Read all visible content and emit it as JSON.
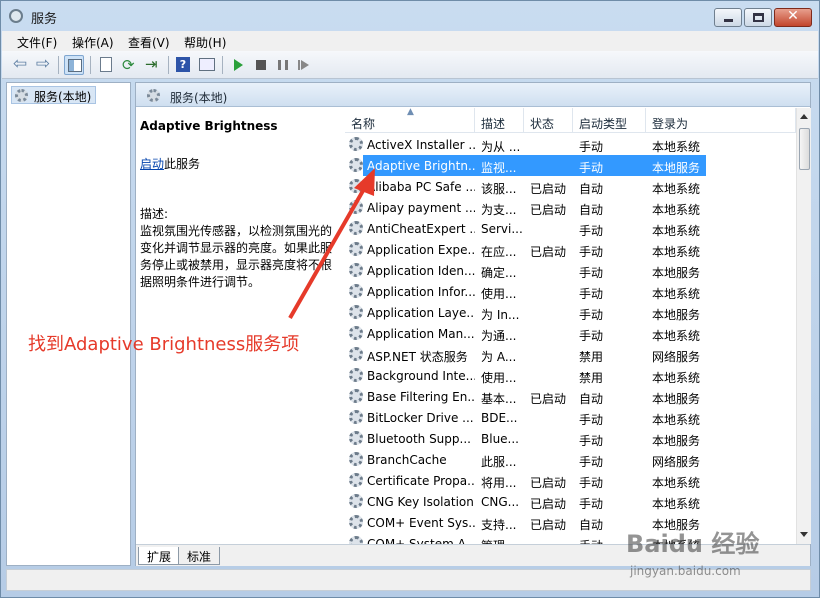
{
  "window": {
    "title": "服务"
  },
  "menu": [
    "文件(F)",
    "操作(A)",
    "查看(V)",
    "帮助(H)"
  ],
  "tree": {
    "root": "服务(本地)"
  },
  "pane": {
    "header": "服务(本地)",
    "selected_name": "Adaptive Brightness",
    "start_link": "启动",
    "start_suffix": "此服务",
    "desc_label": "描述:",
    "desc_text": "监视氛围光传感器，以检测氛围光的变化并调节显示器的亮度。如果此服务停止或被禁用，显示器亮度将不根据照明条件进行调节。"
  },
  "columns": [
    "名称",
    "描述",
    "状态",
    "启动类型",
    "登录为"
  ],
  "services": [
    {
      "name": "ActiveX Installer ...",
      "desc": "为从 ...",
      "status": "",
      "startup": "手动",
      "logon": "本地系统"
    },
    {
      "name": "Adaptive Brightn...",
      "desc": "监视...",
      "status": "",
      "startup": "手动",
      "logon": "本地服务"
    },
    {
      "name": "Alibaba PC Safe ...",
      "desc": "该服...",
      "status": "已启动",
      "startup": "自动",
      "logon": "本地系统"
    },
    {
      "name": "Alipay payment ...",
      "desc": "为支...",
      "status": "已启动",
      "startup": "自动",
      "logon": "本地系统"
    },
    {
      "name": "AntiCheatExpert ...",
      "desc": "Servi...",
      "status": "",
      "startup": "手动",
      "logon": "本地系统"
    },
    {
      "name": "Application Expe...",
      "desc": "在应...",
      "status": "已启动",
      "startup": "手动",
      "logon": "本地系统"
    },
    {
      "name": "Application Iden...",
      "desc": "确定...",
      "status": "",
      "startup": "手动",
      "logon": "本地服务"
    },
    {
      "name": "Application Infor...",
      "desc": "使用...",
      "status": "",
      "startup": "手动",
      "logon": "本地系统"
    },
    {
      "name": "Application Laye...",
      "desc": "为 In...",
      "status": "",
      "startup": "手动",
      "logon": "本地服务"
    },
    {
      "name": "Application Man...",
      "desc": "为通...",
      "status": "",
      "startup": "手动",
      "logon": "本地系统"
    },
    {
      "name": "ASP.NET 状态服务",
      "desc": "为 A...",
      "status": "",
      "startup": "禁用",
      "logon": "网络服务"
    },
    {
      "name": "Background Inte...",
      "desc": "使用...",
      "status": "",
      "startup": "禁用",
      "logon": "本地系统"
    },
    {
      "name": "Base Filtering En...",
      "desc": "基本...",
      "status": "已启动",
      "startup": "自动",
      "logon": "本地服务"
    },
    {
      "name": "BitLocker Drive ...",
      "desc": "BDE...",
      "status": "",
      "startup": "手动",
      "logon": "本地系统"
    },
    {
      "name": "Bluetooth Supp...",
      "desc": "Blue...",
      "status": "",
      "startup": "手动",
      "logon": "本地服务"
    },
    {
      "name": "BranchCache",
      "desc": "此服...",
      "status": "",
      "startup": "手动",
      "logon": "网络服务"
    },
    {
      "name": "Certificate Propa...",
      "desc": "将用...",
      "status": "已启动",
      "startup": "手动",
      "logon": "本地系统"
    },
    {
      "name": "CNG Key Isolation",
      "desc": "CNG...",
      "status": "已启动",
      "startup": "手动",
      "logon": "本地系统"
    },
    {
      "name": "COM+ Event Sys...",
      "desc": "支持...",
      "status": "已启动",
      "startup": "自动",
      "logon": "本地服务"
    },
    {
      "name": "COM+ System A...",
      "desc": "管理...",
      "status": "",
      "startup": "手动",
      "logon": "本地系统"
    }
  ],
  "selected_index": 1,
  "tabs": [
    "扩展",
    "标准"
  ],
  "annotation": "找到Adaptive Brightness服务项",
  "watermark": {
    "logo": "Baidu 经验",
    "url": "jingyan.baidu.com"
  },
  "colors": {
    "selection": "#3399ff",
    "annotation": "#e63a2a",
    "link": "#0645ad"
  }
}
